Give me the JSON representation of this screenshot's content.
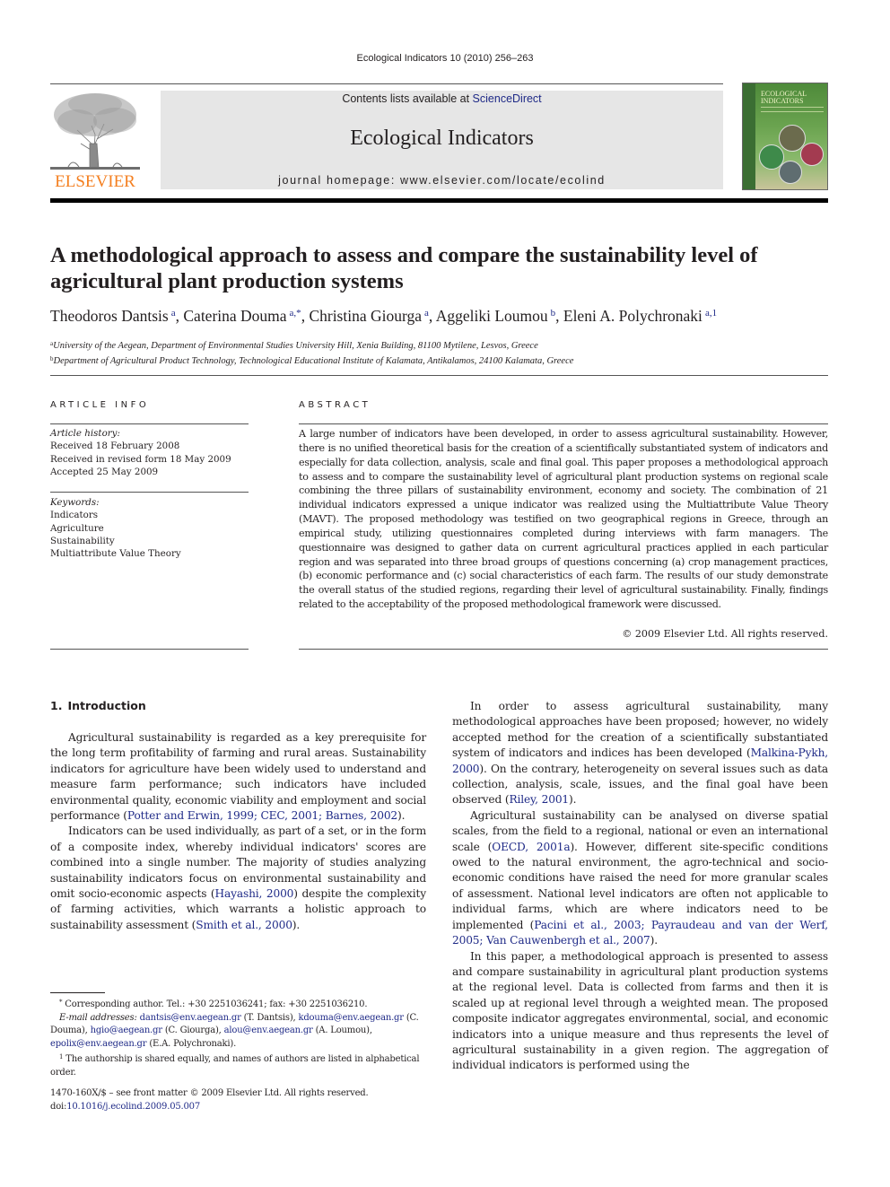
{
  "running_head": "Ecological Indicators 10 (2010) 256–263",
  "header": {
    "publisher_logo_text": "ELSEVIER",
    "contents_prefix": "Contents lists available at ",
    "contents_link": "ScienceDirect",
    "journal_name": "Ecological Indicators",
    "homepage_prefix": "journal homepage: ",
    "homepage_url": "www.elsevier.com/locate/ecolind",
    "cover_title_line1": "ECOLOGICAL",
    "cover_title_line2": "INDICATORS",
    "accent_color": "#f47f20",
    "link_color": "#1f2a87"
  },
  "article": {
    "title": "A methodological approach to assess and compare the sustainability level of agricultural plant production systems",
    "authors": [
      {
        "name": "Theodoros Dantsis",
        "sup": "a"
      },
      {
        "name": "Caterina Douma",
        "sup": "a,*"
      },
      {
        "name": "Christina Giourga",
        "sup": "a"
      },
      {
        "name": "Aggeliki Loumou",
        "sup": "b"
      },
      {
        "name": "Eleni A. Polychronaki",
        "sup": "a,1"
      }
    ],
    "affiliations": [
      {
        "sup": "a",
        "text": "University of the Aegean, Department of Environmental Studies University Hill, Xenia Building, 81100 Mytilene, Lesvos, Greece"
      },
      {
        "sup": "b",
        "text": "Department of Agricultural Product Technology, Technological Educational Institute of Kalamata, Antikalamos, 24100 Kalamata, Greece"
      }
    ]
  },
  "article_info": {
    "heading": "ARTICLE INFO",
    "history_label": "Article history:",
    "history": [
      "Received 18 February 2008",
      "Received in revised form 18 May 2009",
      "Accepted 25 May 2009"
    ],
    "keywords_label": "Keywords:",
    "keywords": [
      "Indicators",
      "Agriculture",
      "Sustainability",
      "Multiattribute Value Theory"
    ]
  },
  "abstract": {
    "heading": "ABSTRACT",
    "text": "A large number of indicators have been developed, in order to assess agricultural sustainability. However, there is no unified theoretical basis for the creation of a scientifically substantiated system of indicators and especially for data collection, analysis, scale and final goal. This paper proposes a methodological approach to assess and to compare the sustainability level of agricultural plant production systems on regional scale combining the three pillars of sustainability environment, economy and society. The combination of 21 individual indicators expressed a unique indicator was realized using the Multiattribute Value Theory (MAVT). The proposed methodology was testified on two geographical regions in Greece, through an empirical study, utilizing questionnaires completed during interviews with farm managers. The questionnaire was designed to gather data on current agricultural practices applied in each particular region and was separated into three broad groups of questions concerning (a) crop management practices, (b) economic performance and (c) social characteristics of each farm. The results of our study demonstrate the overall status of the studied regions, regarding their level of agricultural sustainability. Finally, findings related to the acceptability of the proposed methodological framework were discussed.",
    "copyright": "© 2009 Elsevier Ltd. All rights reserved."
  },
  "introduction": {
    "number": "1.",
    "heading": "Introduction",
    "left_paragraphs": [
      [
        {
          "t": "Agricultural sustainability is regarded as a key prerequisite for the long term profitability of farming and rural areas. Sustainability indicators for agriculture have been widely used to understand and measure farm performance; such indicators have included environmental quality, economic viability and employment and social performance ("
        },
        {
          "link": "Potter and Erwin, 1999; CEC, 2001; Barnes, 2002"
        },
        {
          "t": ")."
        }
      ],
      [
        {
          "t": "Indicators can be used individually, as part of a set, or in the form of a composite index, whereby individual indicators' scores are combined into a single number. The majority of studies analyzing sustainability indicators focus on environmental sustainability and omit socio-economic aspects ("
        },
        {
          "link": "Hayashi, 2000"
        },
        {
          "t": ") despite the complexity of farming activities, which warrants a holistic approach to sustainability assessment ("
        },
        {
          "link": "Smith et al., 2000"
        },
        {
          "t": ")."
        }
      ]
    ],
    "right_paragraphs": [
      [
        {
          "t": "In order to assess agricultural sustainability, many methodological approaches have been proposed; however, no widely accepted method for the creation of a scientifically substantiated system of indicators and indices has been developed ("
        },
        {
          "link": "Malkina-Pykh, 2000"
        },
        {
          "t": "). On the contrary, heterogeneity on several issues such as data collection, analysis, scale, issues, and the final goal have been observed ("
        },
        {
          "link": "Riley, 2001"
        },
        {
          "t": ")."
        }
      ],
      [
        {
          "t": "Agricultural sustainability can be analysed on diverse spatial scales, from the field to a regional, national or even an international scale ("
        },
        {
          "link": "OECD, 2001a"
        },
        {
          "t": "). However, different site-specific conditions owed to the natural environment, the agro-technical and socio-economic conditions have raised the need for more granular scales of assessment. National level indicators are often not applicable to individual farms, which are where indicators need to be implemented ("
        },
        {
          "link": "Pacini et al., 2003; Payraudeau and van der Werf, 2005; Van Cauwenbergh et al., 2007"
        },
        {
          "t": ")."
        }
      ],
      [
        {
          "t": "In this paper, a methodological approach is presented to assess and compare sustainability in agricultural plant production systems at the regional level. Data is collected from farms and then it is scaled up at regional level through a weighted mean. The proposed composite indicator aggregates environmental, social, and economic indicators into a unique measure and thus represents the level of agricultural sustainability in a given region. The aggregation of individual indicators is performed using the"
        }
      ]
    ]
  },
  "footnotes": {
    "corresponding": "Corresponding author. Tel.: +30 2251036241; fax: +30 2251036210.",
    "corresponding_mark": "*",
    "email_label": "E-mail addresses:",
    "emails": [
      {
        "email": "dantsis@env.aegean.gr",
        "who": "(T. Dantsis)"
      },
      {
        "email": "kdouma@env.aegean.gr",
        "who": "(C. Douma)"
      },
      {
        "email": "hgio@aegean.gr",
        "who": "(C. Giourga)"
      },
      {
        "email": "alou@env.aegean.gr",
        "who": "(A. Loumou)"
      },
      {
        "email": "epolix@env.aegean.gr",
        "who": "(E.A. Polychronaki)."
      }
    ],
    "note1_mark": "1",
    "note1": "The authorship is shared equally, and names of authors are listed in alphabetical order."
  },
  "front_matter": {
    "issn_line": "1470-160X/$ – see front matter © 2009 Elsevier Ltd. All rights reserved.",
    "doi_prefix": "doi:",
    "doi": "10.1016/j.ecolind.2009.05.007"
  }
}
